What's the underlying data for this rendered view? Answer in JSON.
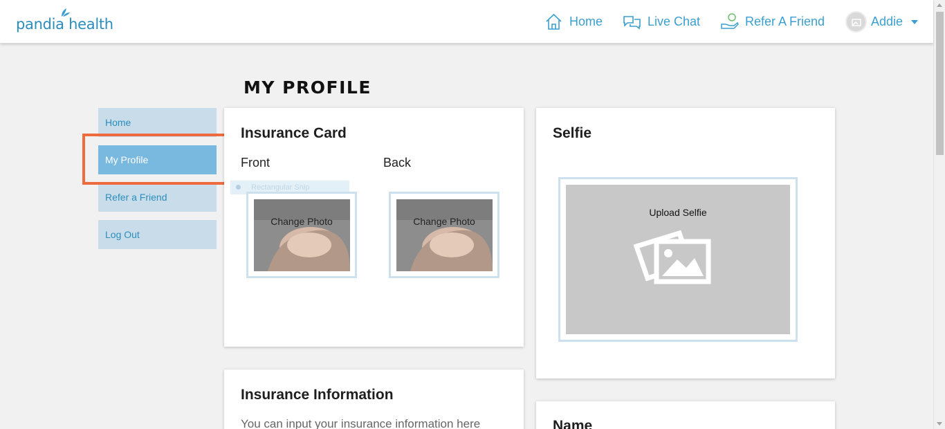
{
  "brand": {
    "logo_text": "pandia health",
    "accent": "#3a9fcf"
  },
  "nav": {
    "home": "Home",
    "live_chat": "Live Chat",
    "refer": "Refer A Friend",
    "user": "Addie"
  },
  "page": {
    "title": "MY PROFILE"
  },
  "sidebar": {
    "items": [
      {
        "label": "Home"
      },
      {
        "label": "My Profile",
        "active": true
      },
      {
        "label": "Refer a Friend"
      },
      {
        "label": "Log Out"
      }
    ]
  },
  "insurance_card": {
    "title": "Insurance Card",
    "front_label": "Front",
    "back_label": "Back",
    "change_photo": "Change Photo",
    "snip_ghost": "Rectangular Snip"
  },
  "selfie": {
    "title": "Selfie",
    "upload_label": "Upload Selfie"
  },
  "insurance_info": {
    "title": "Insurance Information",
    "description": "You can input your insurance information here"
  },
  "name_card": {
    "title": "Name"
  }
}
